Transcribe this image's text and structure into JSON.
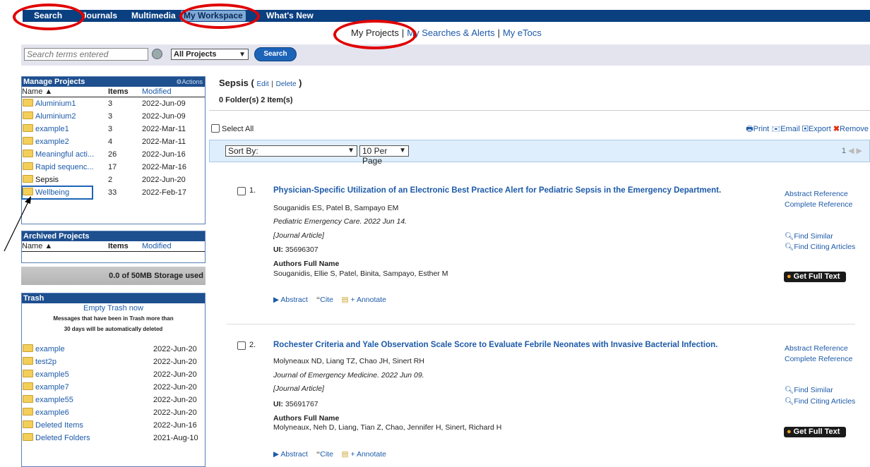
{
  "nav": {
    "items": [
      {
        "label": "Search"
      },
      {
        "label": "Journals"
      },
      {
        "label": "Multimedia"
      },
      {
        "label": "My Workspace"
      },
      {
        "label": "What's New"
      }
    ]
  },
  "subnav": {
    "items": [
      "My Projects",
      "My Searches & Alerts",
      "My eTocs"
    ]
  },
  "search": {
    "placeholder": "Search terms entered",
    "scope": "All Projects",
    "button": "Search"
  },
  "manage": {
    "title": "Manage Projects",
    "actions": "Actions",
    "col_name": "Name ▲",
    "col_items": "Items",
    "col_modified": "Modified",
    "projects": [
      {
        "name": "Aluminium1",
        "items": "3",
        "modified": "2022-Jun-09"
      },
      {
        "name": "Aluminium2",
        "items": "3",
        "modified": "2022-Jun-09"
      },
      {
        "name": "example1",
        "items": "3",
        "modified": "2022-Mar-11"
      },
      {
        "name": "example2",
        "items": "4",
        "modified": "2022-Mar-11"
      },
      {
        "name": "Meaningful acti...",
        "items": "26",
        "modified": "2022-Jun-16"
      },
      {
        "name": "Rapid sequenc...",
        "items": "17",
        "modified": "2022-Mar-16"
      },
      {
        "name": "Sepsis",
        "items": "2",
        "modified": "2022-Jun-20"
      },
      {
        "name": "Wellbeing",
        "items": "33",
        "modified": "2022-Feb-17"
      }
    ]
  },
  "archived": {
    "title": "Archived Projects",
    "col_name": "Name ▲",
    "col_items": "Items",
    "col_modified": "Modified"
  },
  "storage": {
    "text": "0.0 of 50MB Storage used"
  },
  "trash": {
    "title": "Trash",
    "empty": "Empty Trash now",
    "note1": "Messages that have been in Trash more than",
    "note2": "30 days will be automatically deleted",
    "items": [
      {
        "name": "example",
        "date": "2022-Jun-20"
      },
      {
        "name": "test2p",
        "date": "2022-Jun-20"
      },
      {
        "name": "example5",
        "date": "2022-Jun-20"
      },
      {
        "name": "example7",
        "date": "2022-Jun-20"
      },
      {
        "name": "example55",
        "date": "2022-Jun-20"
      },
      {
        "name": "example6",
        "date": "2022-Jun-20"
      },
      {
        "name": "Deleted Items",
        "date": "2022-Jun-16"
      },
      {
        "name": "Deleted Folders",
        "date": "2021-Aug-10"
      }
    ]
  },
  "main": {
    "title": "Sepsis",
    "open_paren": "(",
    "edit": "Edit",
    "pipe": "|",
    "delete": "Delete",
    "close_paren": ")",
    "counts": "0 Folder(s) 2 Item(s)",
    "select_all": "Select All",
    "print": "Print",
    "email": "Email",
    "export": "Export",
    "remove": "Remove",
    "sort_by": "Sort By:",
    "per_page": "10 Per Page",
    "page": "1"
  },
  "results": [
    {
      "num": "1.",
      "title": "Physician-Specific Utilization of an Electronic Best Practice Alert for Pediatric Sepsis in the Emergency Department.",
      "authors": "Souganidis ES, Patel B, Sampayo EM",
      "source": "Pediatric Emergency Care. 2022 Jun 14.",
      "type": "[Journal Article]",
      "ui_label": "UI:",
      "ui": "35696307",
      "full_label": "Authors Full Name",
      "full": "Souganidis, Ellie S, Patel, Binita, Sampayo, Esther M",
      "abstract_ref": "Abstract Reference",
      "complete_ref": "Complete Reference",
      "find_similar": "Find Similar",
      "find_citing": "Find Citing Articles",
      "get_full_text": "Get Full Text",
      "abstract": "Abstract",
      "cite": "Cite",
      "annotate": "+ Annotate"
    },
    {
      "num": "2.",
      "title": "Rochester Criteria and Yale Observation Scale Score to Evaluate Febrile Neonates with Invasive Bacterial Infection.",
      "authors": "Molyneaux ND, Liang TZ, Chao JH, Sinert RH",
      "source": "Journal of Emergency Medicine. 2022 Jun 09.",
      "type": "[Journal Article]",
      "ui_label": "UI:",
      "ui": "35691767",
      "full_label": "Authors Full Name",
      "full": "Molyneaux, Neh D, Liang, Tian Z, Chao, Jennifer H, Sinert, Richard H",
      "abstract_ref": "Abstract Reference",
      "complete_ref": "Complete Reference",
      "find_similar": "Find Similar",
      "find_citing": "Find Citing Articles",
      "get_full_text": "Get Full Text",
      "abstract": "Abstract",
      "cite": "Cite",
      "annotate": "+ Annotate"
    }
  ],
  "colors": {
    "nav_bg": "#0a3f80",
    "panel_head": "#1e4f8f",
    "link": "#1d5aa8",
    "annotation": "#e00000"
  }
}
